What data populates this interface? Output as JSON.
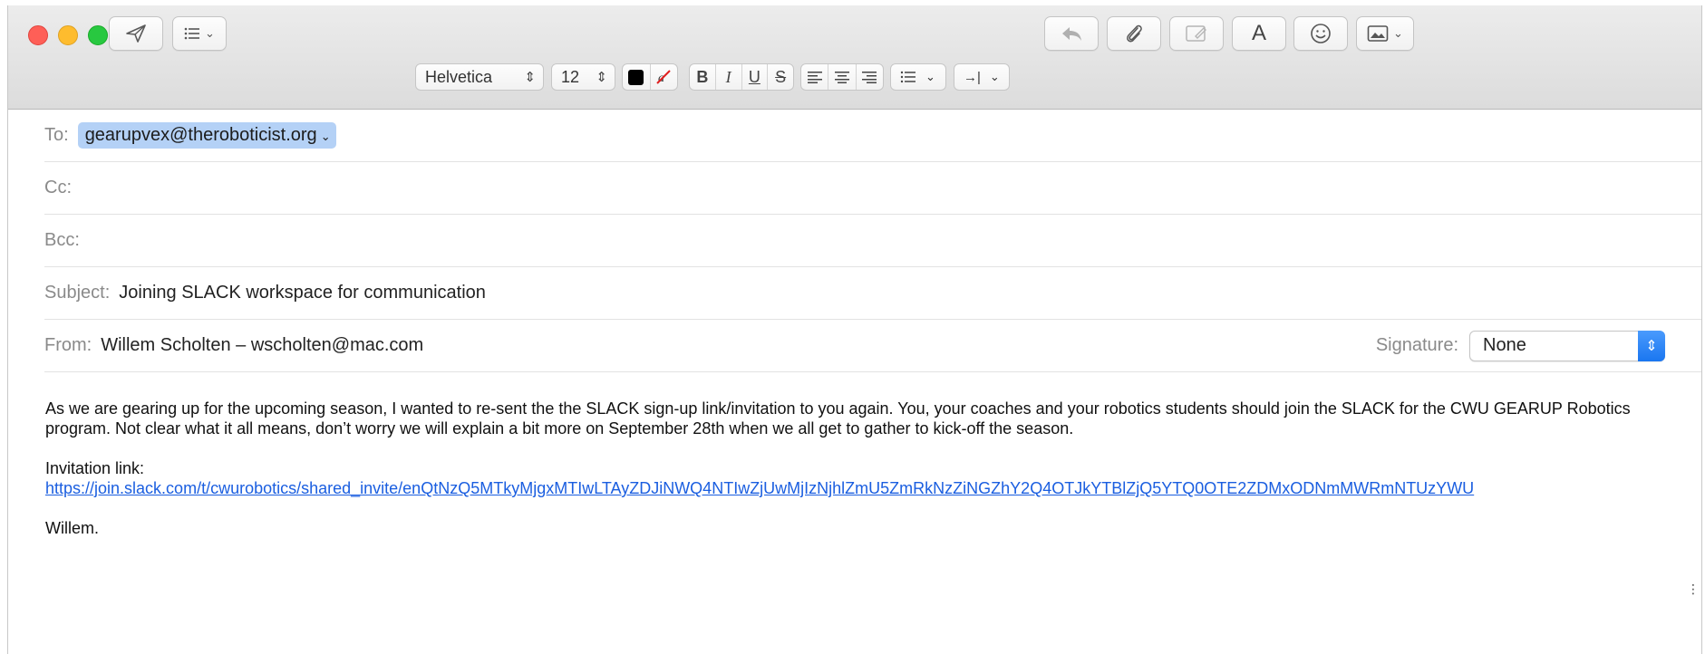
{
  "toolbar": {
    "send_icon": "paper-plane-icon",
    "header_fields_icon": "list-icon",
    "reply_icon": "reply-arrow-icon",
    "attach_icon": "paperclip-icon",
    "markup_icon": "markup-icon",
    "fonts_label": "A",
    "emoji_icon": "smiley-icon",
    "photo_browser_icon": "photo-icon"
  },
  "format": {
    "font_family": "Helvetica",
    "font_size": "12",
    "text_color": "#000000",
    "bold": "B",
    "italic": "I",
    "underline": "U",
    "strike": "S"
  },
  "header": {
    "to_label": "To:",
    "to_value": "gearupvex@theroboticist.org",
    "cc_label": "Cc:",
    "cc_value": "",
    "bcc_label": "Bcc:",
    "bcc_value": "",
    "subject_label": "Subject:",
    "subject_value": "Joining SLACK workspace for communication",
    "from_label": "From:",
    "from_value": "Willem Scholten – wscholten@mac.com",
    "signature_label": "Signature:",
    "signature_value": "None"
  },
  "body": {
    "paragraph1": "As we are gearing up for the upcoming season, I wanted to re-sent the the SLACK sign-up link/invitation to you again.  You, your coaches and your robotics students should join the SLACK for the CWU GEARUP Robotics program.  Not clear what it all means, don’t worry we will explain a bit more on September 28th when we all get to gather to kick-off the season.",
    "invite_label": "Invitation link:",
    "invite_link": "https://join.slack.com/t/cwurobotics/shared_invite/enQtNzQ5MTkyMjgxMTIwLTAyZDJiNWQ4NTIwZjUwMjIzNjhlZmU5ZmRkNzZiNGZhY2Q4OTJkYTBlZjQ5YTQ0OTE2ZDMxODNmMWRmNTUzYWU",
    "signoff": "Willem."
  },
  "colors": {
    "close": "#fe5f57",
    "minimize": "#febc2e",
    "zoom": "#28c840",
    "token": "#b4d1f6",
    "link": "#1a5ee0",
    "select_accent": "#1a76f0"
  }
}
